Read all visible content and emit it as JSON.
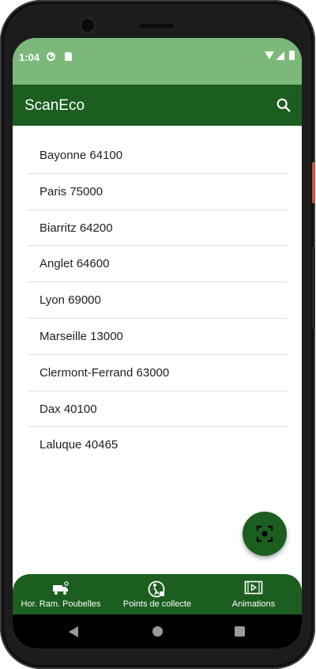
{
  "status_bar": {
    "time": "1:04",
    "icons": [
      "gauge-icon",
      "sim-card-icon",
      "wifi-icon",
      "cell-signal-icon",
      "battery-icon"
    ]
  },
  "app_bar": {
    "title": "ScanEco",
    "search_icon": "search-icon"
  },
  "cities": [
    "Bayonne 64100",
    "Paris 75000",
    "Biarritz 64200",
    "Anglet 64600",
    "Lyon 69000",
    "Marseille 13000",
    "Clermont-Ferrand 63000",
    "Dax 40100",
    "Laluque 40465"
  ],
  "fab": {
    "icon": "scan-icon"
  },
  "bottom_nav": {
    "items": [
      {
        "label": "Hor. Ram. Poubelles",
        "icon": "garbage-truck-icon"
      },
      {
        "label": "Points de collecte",
        "icon": "recycling-person-icon"
      },
      {
        "label": "Animations",
        "icon": "video-icon"
      }
    ]
  },
  "colors": {
    "status_bar": "#7cb87a",
    "primary": "#1b5e20",
    "background": "#ffffff",
    "divider": "#e1e1e1"
  }
}
